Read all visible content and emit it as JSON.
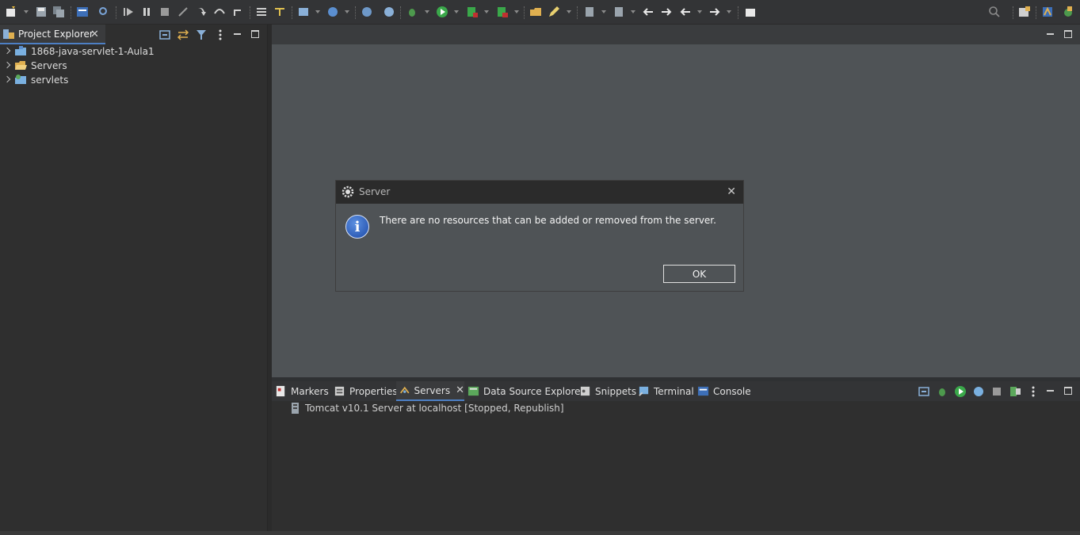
{
  "left_panel": {
    "tab_label": "Project Explorer",
    "tree": [
      {
        "label": "1868-java-servlet-1-Aula1",
        "icon": "project-folder-icon"
      },
      {
        "label": "Servers",
        "icon": "open-folder-icon"
      },
      {
        "label": "servlets",
        "icon": "web-project-icon"
      }
    ]
  },
  "dialog": {
    "title": "Server",
    "message": "There are no resources that can be added or removed from the server.",
    "ok_label": "OK"
  },
  "bottom_panel": {
    "tabs": [
      {
        "label": "Markers",
        "icon": "markers-icon",
        "active": false
      },
      {
        "label": "Properties",
        "icon": "properties-icon",
        "active": false
      },
      {
        "label": "Servers",
        "icon": "servers-icon",
        "active": true
      },
      {
        "label": "Data Source Explorer",
        "icon": "data-source-icon",
        "active": false
      },
      {
        "label": "Snippets",
        "icon": "snippets-icon",
        "active": false
      },
      {
        "label": "Terminal",
        "icon": "terminal-icon",
        "active": false
      },
      {
        "label": "Console",
        "icon": "console-icon",
        "active": false
      }
    ],
    "server_entry": "Tomcat v10.1 Server at localhost  [Stopped, Republish]"
  },
  "colors": {
    "accent": "#4d7fc4",
    "editor_bg": "#4f5356",
    "panel_bg": "#2f2f2f"
  }
}
